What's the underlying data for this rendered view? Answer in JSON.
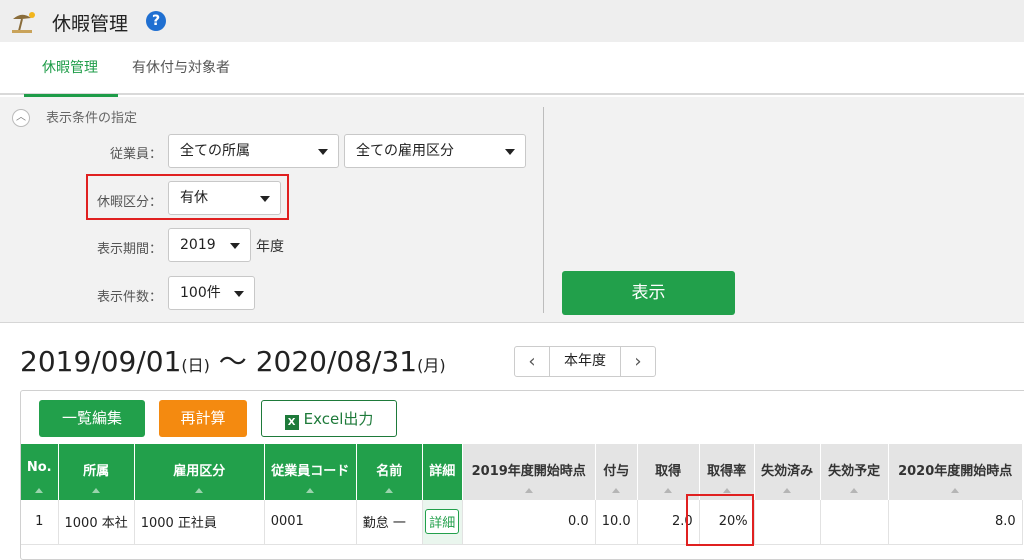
{
  "app": {
    "title": "休暇管理",
    "icon": "beach-umbrella-icon",
    "help": "?"
  },
  "tabs": [
    {
      "label": "休暇管理",
      "active": true
    },
    {
      "label": "有休付与対象者",
      "active": false
    }
  ],
  "filter": {
    "title": "表示条件の指定",
    "employee_label": "従業員：",
    "affiliation_value": "全ての所属",
    "employment_value": "全ての雇用区分",
    "leave_type_label": "休暇区分：",
    "leave_type_value": "有休",
    "period_label": "表示期間：",
    "year_value": "2019",
    "year_suffix": "年度",
    "count_label": "表示件数：",
    "count_value": "100件",
    "show_button": "表示"
  },
  "range": {
    "start": "2019/09/01",
    "start_day": "(日)",
    "sep": "〜",
    "end": "2020/08/31",
    "end_day": "(月)",
    "prev": "‹",
    "current": "本年度",
    "next": "›"
  },
  "toolbar": {
    "bulk_edit": "一覧編集",
    "recalc": "再計算",
    "excel_icon": "X",
    "excel": "Excel出力"
  },
  "table": {
    "headers": [
      "No.",
      "所属",
      "雇用区分",
      "従業員コード",
      "名前",
      "詳細",
      "2019年度開始時点",
      "付与",
      "取得",
      "取得率",
      "失効済み",
      "失効予定",
      "2020年度開始時点"
    ],
    "rows": [
      {
        "no": "1",
        "affiliation": "1000 本社",
        "employment": "1000 正社員",
        "code": "0001",
        "name": "勤怠 一",
        "detail": "詳細",
        "start_balance": "0.0",
        "grant": "10.0",
        "taken": "2.0",
        "rate": "20%",
        "expired": "",
        "to_expire": "",
        "end_balance": "8.0"
      }
    ]
  },
  "colors": {
    "green": "#22a04b",
    "orange": "#f48a10",
    "highlight": "#e02020",
    "help_blue": "#1f6fd1"
  }
}
